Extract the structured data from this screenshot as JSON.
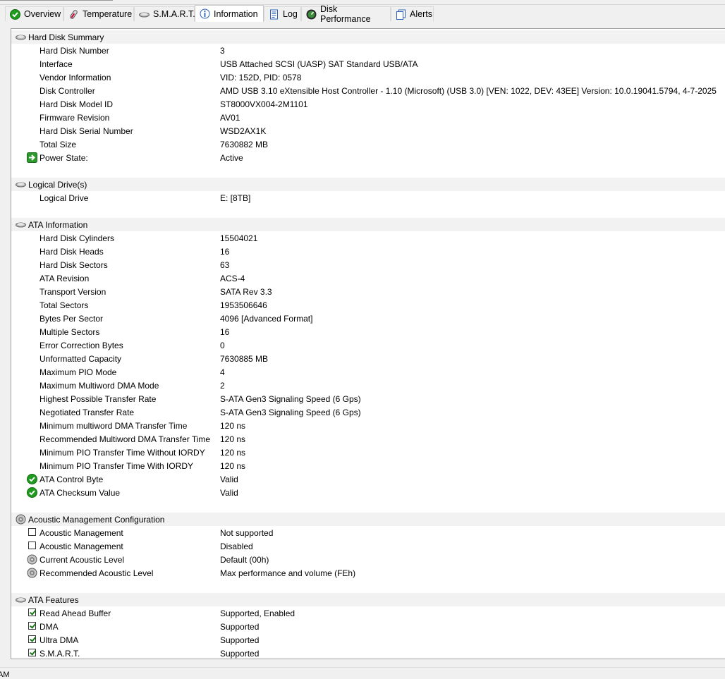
{
  "tabs": [
    {
      "label": "Overview",
      "icon": "check-circle-icon"
    },
    {
      "label": "Temperature",
      "icon": "thermometer-icon"
    },
    {
      "label": "S.M.A.R.T.",
      "icon": "disk-icon"
    },
    {
      "label": "Information",
      "icon": "info-icon"
    },
    {
      "label": "Log",
      "icon": "document-icon"
    },
    {
      "label": "Disk Performance",
      "icon": "gauge-icon"
    },
    {
      "label": "Alerts",
      "icon": "pages-icon"
    }
  ],
  "active_tab": "Information",
  "sections": {
    "summary": {
      "title": "Hard Disk Summary",
      "rows": [
        {
          "label": "Hard Disk Number",
          "value": "3"
        },
        {
          "label": "Interface",
          "value": "USB Attached SCSI (UASP) SAT Standard USB/ATA"
        },
        {
          "label": "Vendor Information",
          "value": "VID: 152D, PID: 0578"
        },
        {
          "label": "Disk Controller",
          "value": "AMD USB 3.10 eXtensible Host Controller - 1.10 (Microsoft) (USB 3.0) [VEN: 1022, DEV: 43EE] Version: 10.0.19041.5794, 4-7-2025"
        },
        {
          "label": "Hard Disk Model ID",
          "value": "ST8000VX004-2M1101"
        },
        {
          "label": "Firmware Revision",
          "value": "AV01"
        },
        {
          "label": "Hard Disk Serial Number",
          "value": "WSD2AX1K"
        },
        {
          "label": "Total Size",
          "value": "7630882 MB"
        },
        {
          "label": "Power State:",
          "value": "Active"
        }
      ]
    },
    "logical": {
      "title": "Logical Drive(s)",
      "rows": [
        {
          "label": "Logical Drive",
          "value": "E: [8TB]"
        }
      ]
    },
    "ata": {
      "title": "ATA Information",
      "rows": [
        {
          "label": "Hard Disk Cylinders",
          "value": "15504021"
        },
        {
          "label": "Hard Disk Heads",
          "value": "16"
        },
        {
          "label": "Hard Disk Sectors",
          "value": "63"
        },
        {
          "label": "ATA Revision",
          "value": "ACS-4"
        },
        {
          "label": "Transport Version",
          "value": "SATA Rev 3.3"
        },
        {
          "label": "Total Sectors",
          "value": "1953506646"
        },
        {
          "label": "Bytes Per Sector",
          "value": "4096 [Advanced Format]"
        },
        {
          "label": "Multiple Sectors",
          "value": "16"
        },
        {
          "label": "Error Correction Bytes",
          "value": "0"
        },
        {
          "label": "Unformatted Capacity",
          "value": "7630885 MB"
        },
        {
          "label": "Maximum PIO Mode",
          "value": "4"
        },
        {
          "label": "Maximum Multiword DMA Mode",
          "value": "2"
        },
        {
          "label": "Highest Possible Transfer Rate",
          "value": "S-ATA Gen3 Signaling Speed (6 Gps)"
        },
        {
          "label": "Negotiated Transfer Rate",
          "value": "S-ATA Gen3 Signaling Speed (6 Gps)"
        },
        {
          "label": "Minimum multiword DMA Transfer Time",
          "value": "120 ns"
        },
        {
          "label": "Recommended Multiword DMA Transfer Time",
          "value": "120 ns"
        },
        {
          "label": "Minimum PIO Transfer Time Without IORDY",
          "value": "120 ns"
        },
        {
          "label": "Minimum PIO Transfer Time With IORDY",
          "value": "120 ns"
        },
        {
          "label": "ATA Control Byte",
          "value": "Valid"
        },
        {
          "label": "ATA Checksum Value",
          "value": "Valid"
        }
      ]
    },
    "acoustic": {
      "title": "Acoustic Management Configuration",
      "rows": [
        {
          "label": "Acoustic Management",
          "value": "Not supported",
          "checked": false
        },
        {
          "label": "Acoustic Management",
          "value": "Disabled",
          "checked": false
        },
        {
          "label": "Current Acoustic Level",
          "value": "Default (00h)"
        },
        {
          "label": "Recommended Acoustic Level",
          "value": "Max performance and volume (FEh)"
        }
      ]
    },
    "features": {
      "title": "ATA Features",
      "rows": [
        {
          "label": "Read Ahead Buffer",
          "value": "Supported, Enabled",
          "checked": true
        },
        {
          "label": "DMA",
          "value": "Supported",
          "checked": true
        },
        {
          "label": "Ultra DMA",
          "value": "Supported",
          "checked": true
        },
        {
          "label": "S.M.A.R.T.",
          "value": "Supported",
          "checked": true
        }
      ]
    }
  },
  "statusbar": {
    "text": "AM"
  },
  "colors": {
    "valid_green": "#1f9b1f",
    "section_bg": "#f2f2f2",
    "tab_border": "#c8c8c8"
  }
}
